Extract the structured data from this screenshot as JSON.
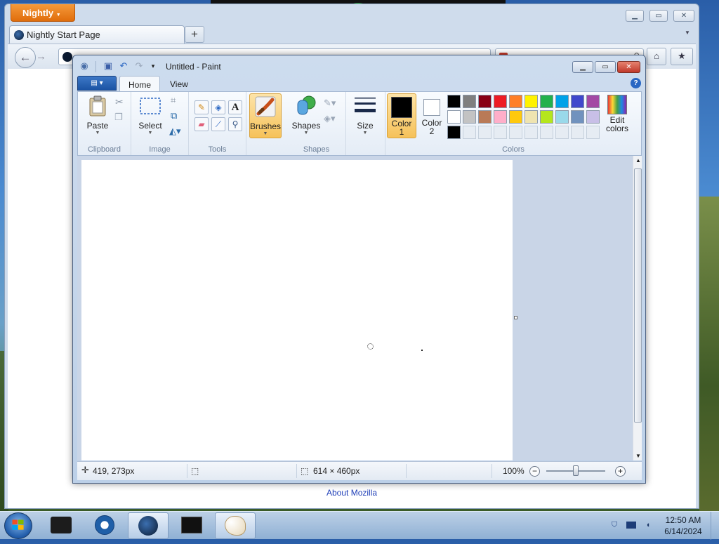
{
  "browser": {
    "app_button": "Nightly",
    "tab_title": "Nightly Start Page",
    "new_tab_label": "+",
    "about_link": "About Mozilla"
  },
  "paint": {
    "window_title": "Untitled - Paint",
    "tabs": [
      "Home",
      "View"
    ],
    "groups": {
      "clipboard": "Clipboard",
      "image": "Image",
      "tools": "Tools",
      "shapes": "Shapes",
      "colors": "Colors"
    },
    "buttons": {
      "paste": "Paste",
      "select": "Select",
      "brushes": "Brushes",
      "shapes": "Shapes",
      "size": "Size",
      "color1": "Color\n1",
      "color2": "Color\n2",
      "edit_colors": "Edit\ncolors"
    },
    "color1_hex": "#000000",
    "color2_hex": "#ffffff",
    "palette": [
      [
        "#000000",
        "#7f7f7f",
        "#880015",
        "#ed1c24",
        "#ff7f27",
        "#fff200",
        "#22b14c",
        "#00a2e8",
        "#3f48cc",
        "#a349a4"
      ],
      [
        "#ffffff",
        "#c3c3c3",
        "#b97a57",
        "#ffaec9",
        "#ffc90e",
        "#efe4b0",
        "#b5e61d",
        "#99d9ea",
        "#7092be",
        "#c8bfe7"
      ],
      [
        "#000000",
        "",
        "",
        "",
        "",
        "",
        "",
        "",
        "",
        ""
      ]
    ],
    "status": {
      "cursor_pos": "419, 273px",
      "canvas_size": "614 × 460px",
      "zoom": "100%"
    }
  },
  "taskbar": {
    "time": "12:50 AM",
    "date": "6/14/2024"
  }
}
